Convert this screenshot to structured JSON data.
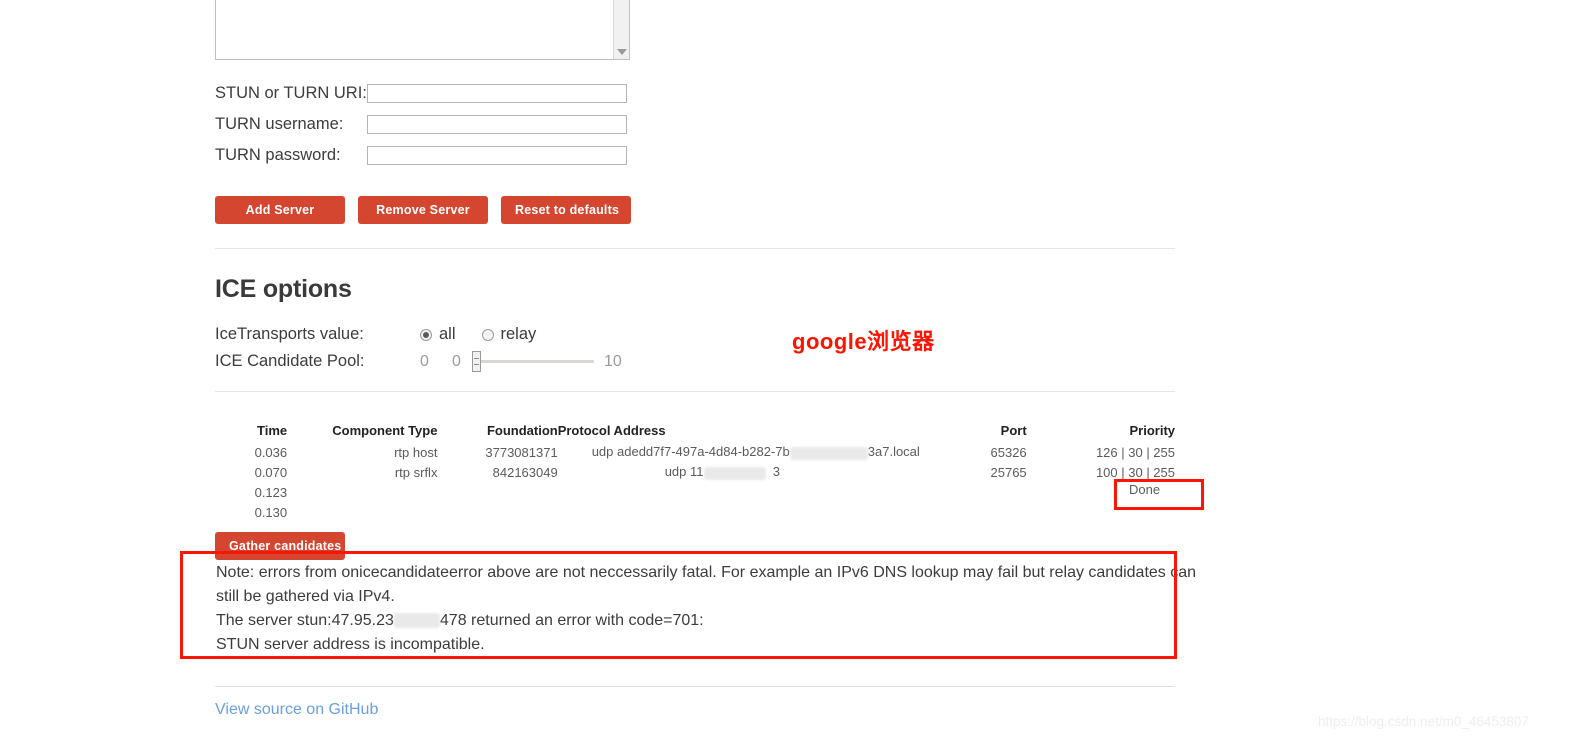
{
  "form": {
    "fields": [
      {
        "label": "STUN or TURN URI:",
        "value": "",
        "placeholder": ""
      },
      {
        "label": "TURN username:",
        "value": "",
        "placeholder": ""
      },
      {
        "label": "TURN password:",
        "value": "",
        "placeholder": ""
      }
    ]
  },
  "buttons": {
    "add_server": "Add Server",
    "remove_server": "Remove Server",
    "reset_defaults": "Reset to defaults",
    "gather_candidates": "Gather candidates"
  },
  "ice_options": {
    "heading": "ICE options",
    "transports": {
      "label": "IceTransports value:",
      "options": [
        {
          "label": "all",
          "checked": true
        },
        {
          "label": "relay",
          "checked": false
        }
      ]
    },
    "candidate_pool": {
      "label": "ICE Candidate Pool:",
      "value": "0",
      "min": "0",
      "max": "10"
    }
  },
  "candidates_table": {
    "headers": [
      "Time",
      "Component Type",
      "Foundation",
      "Protocol Address",
      "Port",
      "Priority"
    ],
    "rows": [
      {
        "time": "0.036",
        "component": "rtp host",
        "foundation": "3773081371",
        "protocol_prefix": "udp adedd7f7-497a-4d84-b282-7b",
        "protocol_suffix": "3a7.local",
        "port": "65326",
        "priority": "126 | 30 | 255"
      },
      {
        "time": "0.070",
        "component": "rtp srflx",
        "foundation": "842163049",
        "protocol_prefix": "udp 11",
        "protocol_suffix": "  3",
        "port": "25765",
        "priority": "100 | 30 | 255"
      },
      {
        "time": "0.123",
        "component": "",
        "foundation": "",
        "protocol_prefix": "",
        "protocol_suffix": "",
        "port": "",
        "priority": ""
      },
      {
        "time": "0.130",
        "component": "",
        "foundation": "",
        "protocol_prefix": "",
        "protocol_suffix": "",
        "port": "",
        "priority": ""
      }
    ],
    "status": "Done"
  },
  "note": {
    "line1": "Note: errors from onicecandidateerror above are not neccessarily fatal. For example an IPv6 DNS lookup may fail but relay candidates can",
    "line2": "still be gathered via IPv4.",
    "line3_prefix": "The server stun:47.95.23",
    "line3_suffix": "478 returned an error with code=701:",
    "line4": "STUN server address is incompatible."
  },
  "annotations": {
    "chinese_label": "google浏览器",
    "highlight_color": "#fa1505"
  },
  "footer": {
    "github_link": "View source on GitHub",
    "watermark": "https://blog.csdn.net/m0_46453807"
  }
}
